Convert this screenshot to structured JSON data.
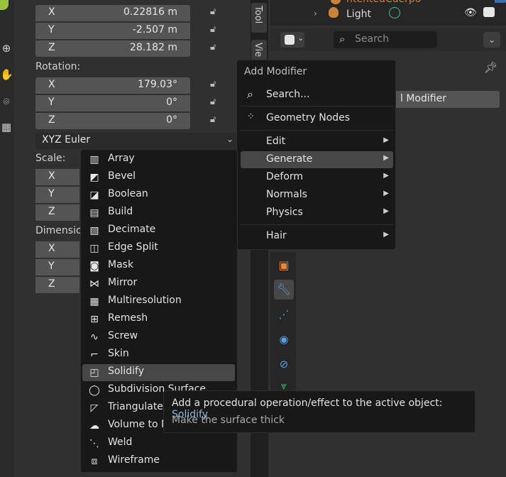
{
  "transform": {
    "location": [
      {
        "axis": "X",
        "value": "0.22816 m"
      },
      {
        "axis": "Y",
        "value": "-2.507 m"
      },
      {
        "axis": "Z",
        "value": "28.182 m"
      }
    ],
    "rotation_label": "Rotation:",
    "rotation": [
      {
        "axis": "X",
        "value": "179.03°"
      },
      {
        "axis": "Y",
        "value": "0°"
      },
      {
        "axis": "Z",
        "value": "0°"
      }
    ],
    "rotation_mode": "XYZ Euler",
    "scale_label": "Scale:",
    "scale_axes": [
      "X",
      "Y",
      "Z"
    ],
    "dimensions_label": "Dimension",
    "dimensions_axes": [
      "X",
      "Y",
      "Z"
    ]
  },
  "tabs": {
    "tool": "Tool",
    "view": "Vie"
  },
  "outliner": {
    "row1": "ntentedCuerpo",
    "row2": "Light"
  },
  "properties": {
    "search_placeholder": "Search",
    "modifier_btn": "l Modifier"
  },
  "add_modifier_menu": {
    "title": "Add Modifier",
    "search": "Search...",
    "geometry_nodes": "Geometry Nodes",
    "items": [
      "Edit",
      "Generate",
      "Deform",
      "Normals",
      "Physics"
    ],
    "hair": "Hair",
    "active": "Generate"
  },
  "generate_submenu": {
    "items": [
      "Array",
      "Bevel",
      "Boolean",
      "Build",
      "Decimate",
      "Edge Split",
      "Mask",
      "Mirror",
      "Multiresolution",
      "Remesh",
      "Screw",
      "Skin",
      "Solidify",
      "Subdivision Surface",
      "Triangulate",
      "Volume to M",
      "Weld",
      "Wireframe"
    ],
    "active": "Solidify"
  },
  "tooltip": {
    "line1_prefix": "Add a procedural operation/effect to the active object: ",
    "line1_name": "Solidify",
    "line2": "Make the surface thick"
  },
  "colors": {
    "accent": "#8fb4d9",
    "active_item": "#474747",
    "menu_bg": "#181818"
  }
}
